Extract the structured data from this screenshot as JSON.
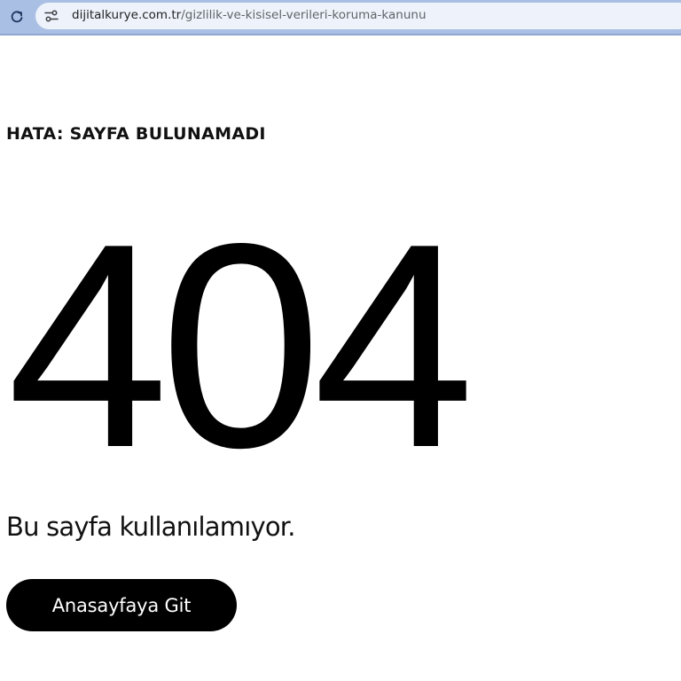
{
  "browser": {
    "url_domain": "dijitalkurye.com.tr",
    "url_path": "/gizlilik-ve-kisisel-verileri-koruma-kanunu",
    "reload_icon": "reload-icon",
    "site_settings_icon": "site-settings-icon"
  },
  "page": {
    "heading": "HATA: SAYFA BULUNAMADI",
    "code": "404",
    "message": "Bu sayfa kullanılamıyor.",
    "button_label": "Anasayfaya Git"
  },
  "colors": {
    "toolbar": "#a9bfe3",
    "urlbar": "#eef3fb",
    "button_bg": "#000000",
    "button_text": "#ffffff"
  }
}
